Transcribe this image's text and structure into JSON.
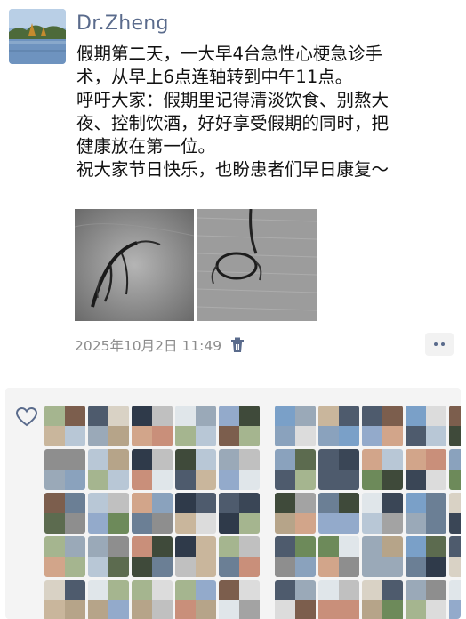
{
  "post": {
    "username": "Dr.Zheng",
    "lines": [
      "假期第二天，一大早4台急性心梗急诊手",
      "术，从早上6点连轴转到中午11点。",
      "呼吁大家：假期里记得清淡饮食、别熬大",
      "夜、控制饮酒，好好享受假期的同时，把",
      "健康放在第一位。",
      "祝大家节日快乐，也盼患者们早日康复～"
    ],
    "timestamp": "2025年10月2日  11:49"
  },
  "icons": {
    "trash": "trash-icon",
    "more": "more-dots-icon",
    "heart": "heart-outline-icon"
  },
  "colors": {
    "username": "#5a6b8c",
    "meta": "#8c8c8c",
    "panel": "#f4f4f4"
  }
}
